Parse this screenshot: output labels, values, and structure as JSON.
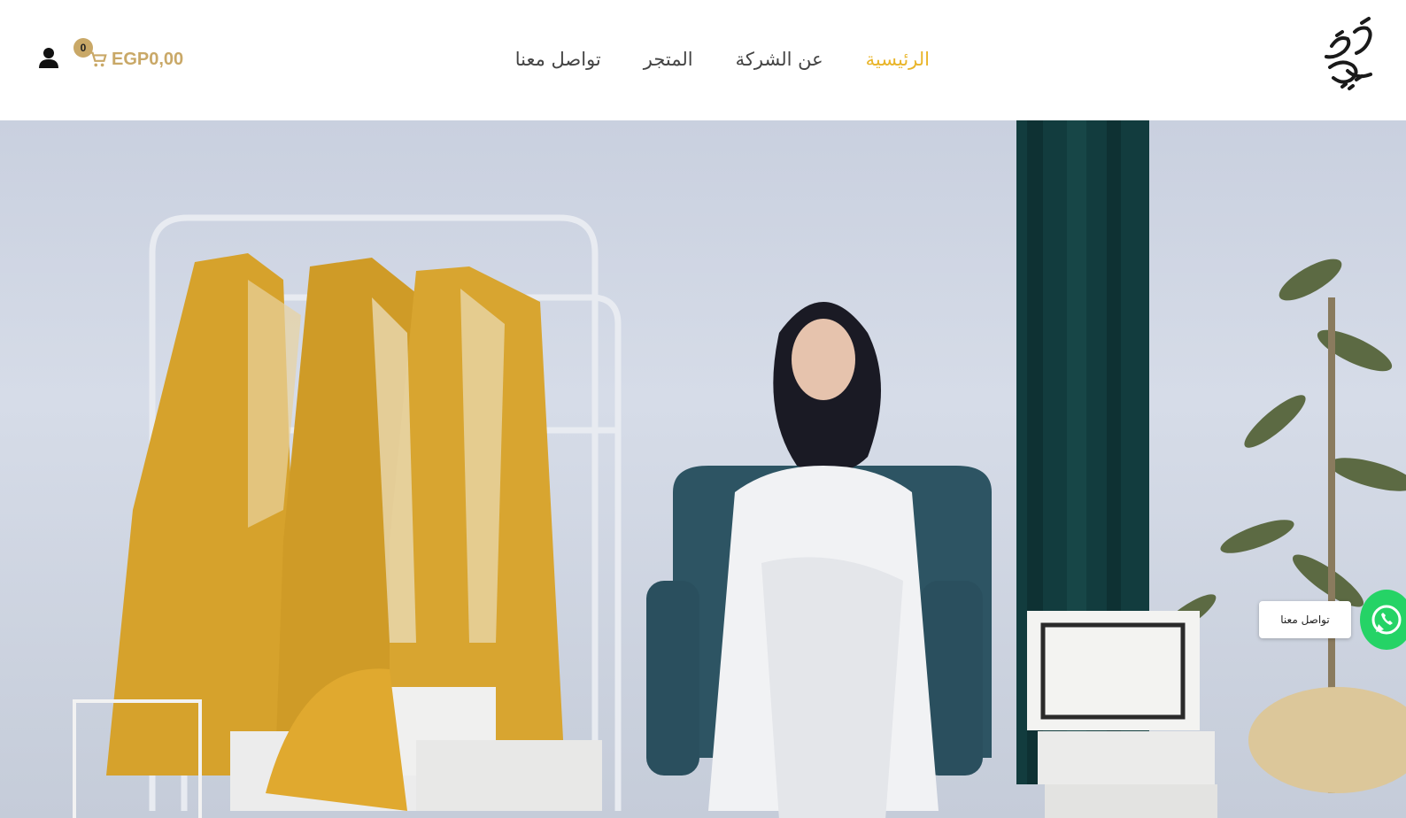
{
  "header": {
    "logo_icon": "brand-calligraphy-logo",
    "nav": [
      {
        "label": "الرئيسية",
        "active": true
      },
      {
        "label": "عن الشركة",
        "active": false
      },
      {
        "label": "المتجر",
        "active": false
      },
      {
        "label": "تواصل معنا",
        "active": false
      }
    ],
    "cart": {
      "total": "EGP0,00",
      "count": "0",
      "icon": "cart-icon"
    },
    "account_icon": "user-icon"
  },
  "hero": {
    "image": "hero-video-frame"
  },
  "whatsapp": {
    "label": "تواصل معنا",
    "icon": "whatsapp-icon"
  },
  "colors": {
    "accent": "#e9b52a",
    "nav_text": "#444444",
    "cart_text": "#c9a867",
    "whatsapp": "#25d366"
  }
}
